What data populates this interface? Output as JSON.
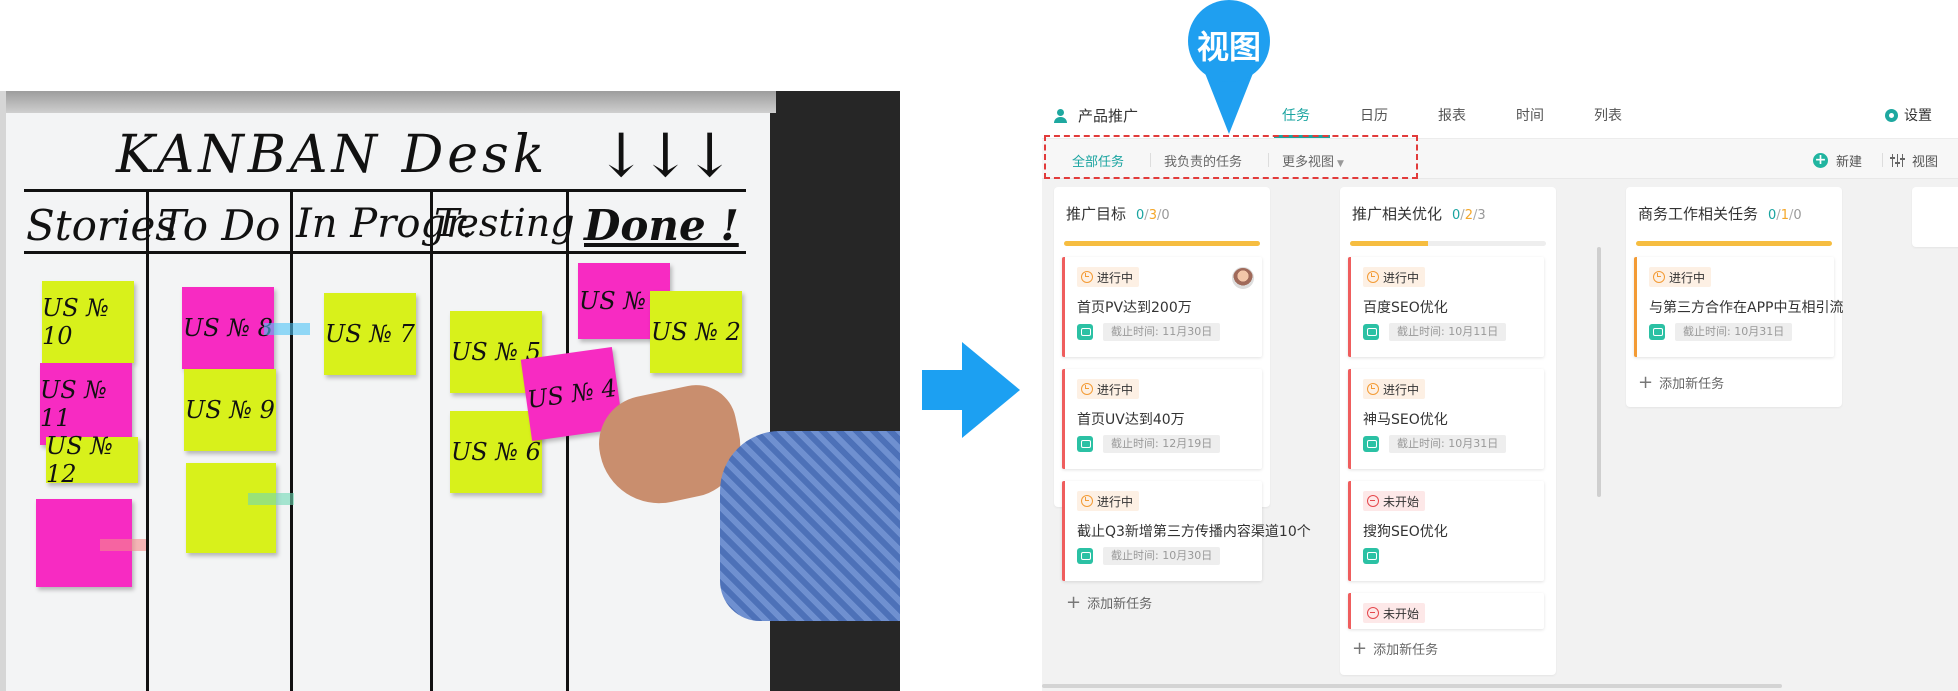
{
  "photo": {
    "board_title": "KANBAN Desk",
    "arrows": "↓↓↓",
    "columns": [
      "Stories",
      "To Do",
      "In Progr.",
      "Testing",
      "Done !"
    ],
    "notes": [
      "US № 10",
      "US № 11",
      "US № 12",
      "US № 8",
      "US № 9",
      "US № 7",
      "US № 5",
      "US № 6",
      "US № 4",
      "US № 1",
      "US № 2"
    ]
  },
  "callout": {
    "label": "视图"
  },
  "app": {
    "project_name": "产品推广",
    "nav": [
      "任务",
      "日历",
      "报表",
      "时间",
      "列表"
    ],
    "settings_label": "设置",
    "views": [
      "全部任务",
      "我负责的任务",
      "更多视图"
    ],
    "new_label": "新建",
    "view_label": "视图",
    "add_task_label": "添加新任务",
    "columns": [
      {
        "title": "推广目标",
        "count_done": "0",
        "count_progress": "3",
        "count_other": "0",
        "progress": 1.0,
        "cards": [
          {
            "status": "进行中",
            "title": "首页PV达到200万",
            "deadline": "截止时间: 11月30日"
          },
          {
            "status": "进行中",
            "title": "首页UV达到40万",
            "deadline": "截止时间: 12月19日"
          },
          {
            "status": "进行中",
            "title": "截止Q3新增第三方传播内容渠道10个",
            "deadline": "截止时间: 10月30日"
          }
        ]
      },
      {
        "title": "推广相关优化",
        "count_done": "0",
        "count_progress": "2",
        "count_other": "3",
        "progress": 0.4,
        "cards": [
          {
            "status": "进行中",
            "title": "百度SEO优化",
            "deadline": "截止时间: 10月11日"
          },
          {
            "status": "进行中",
            "title": "神马SEO优化",
            "deadline": "截止时间: 10月31日"
          },
          {
            "status": "未开始",
            "title": "搜狗SEO优化"
          },
          {
            "status": "未开始"
          }
        ]
      },
      {
        "title": "商务工作相关任务",
        "count_done": "0",
        "count_progress": "1",
        "count_other": "0",
        "progress": 1.0,
        "cards": [
          {
            "status": "进行中",
            "title": "与第三方合作在APP中互相引流",
            "deadline": "截止时间: 10月31日"
          }
        ]
      }
    ]
  },
  "colors": {
    "accent": "#1aa4a0",
    "arrow": "#1ca0f2",
    "callout": "#1f9ff0",
    "highlight_box": "#e23b3b",
    "progress": "#f6bd40",
    "card_border": "#ef5d5d"
  },
  "icons": [
    "user-icon",
    "gear-icon",
    "plus-circle-icon",
    "sliders-icon",
    "clock-icon",
    "stop-icon",
    "chat-icon",
    "avatar",
    "plus-icon",
    "arrow-right-icon",
    "map-pin-icon"
  ]
}
